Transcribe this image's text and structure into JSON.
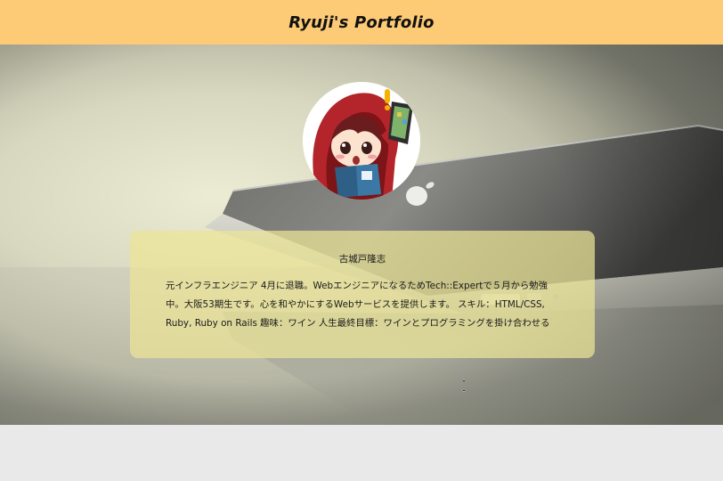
{
  "header": {
    "title": "Ryuji's Portfolio",
    "background": "#fdca75"
  },
  "hero": {
    "image": "laptop-photo",
    "avatar": "chibi-character-avatar"
  },
  "profile": {
    "name": "古城戸隆志",
    "bio": "元インフラエンジニア 4月に退職。WebエンジニアになるためTech::Expertで５月から勉強中。大阪53期生です。心を和やかにするWebサービスを提供します。 スキル：HTML/CSS, Ruby, Ruby on Rails 趣味：ワイン 人生最終目標：ワインとプログラミングを掛け合わせる",
    "card_color": "#ece496"
  }
}
